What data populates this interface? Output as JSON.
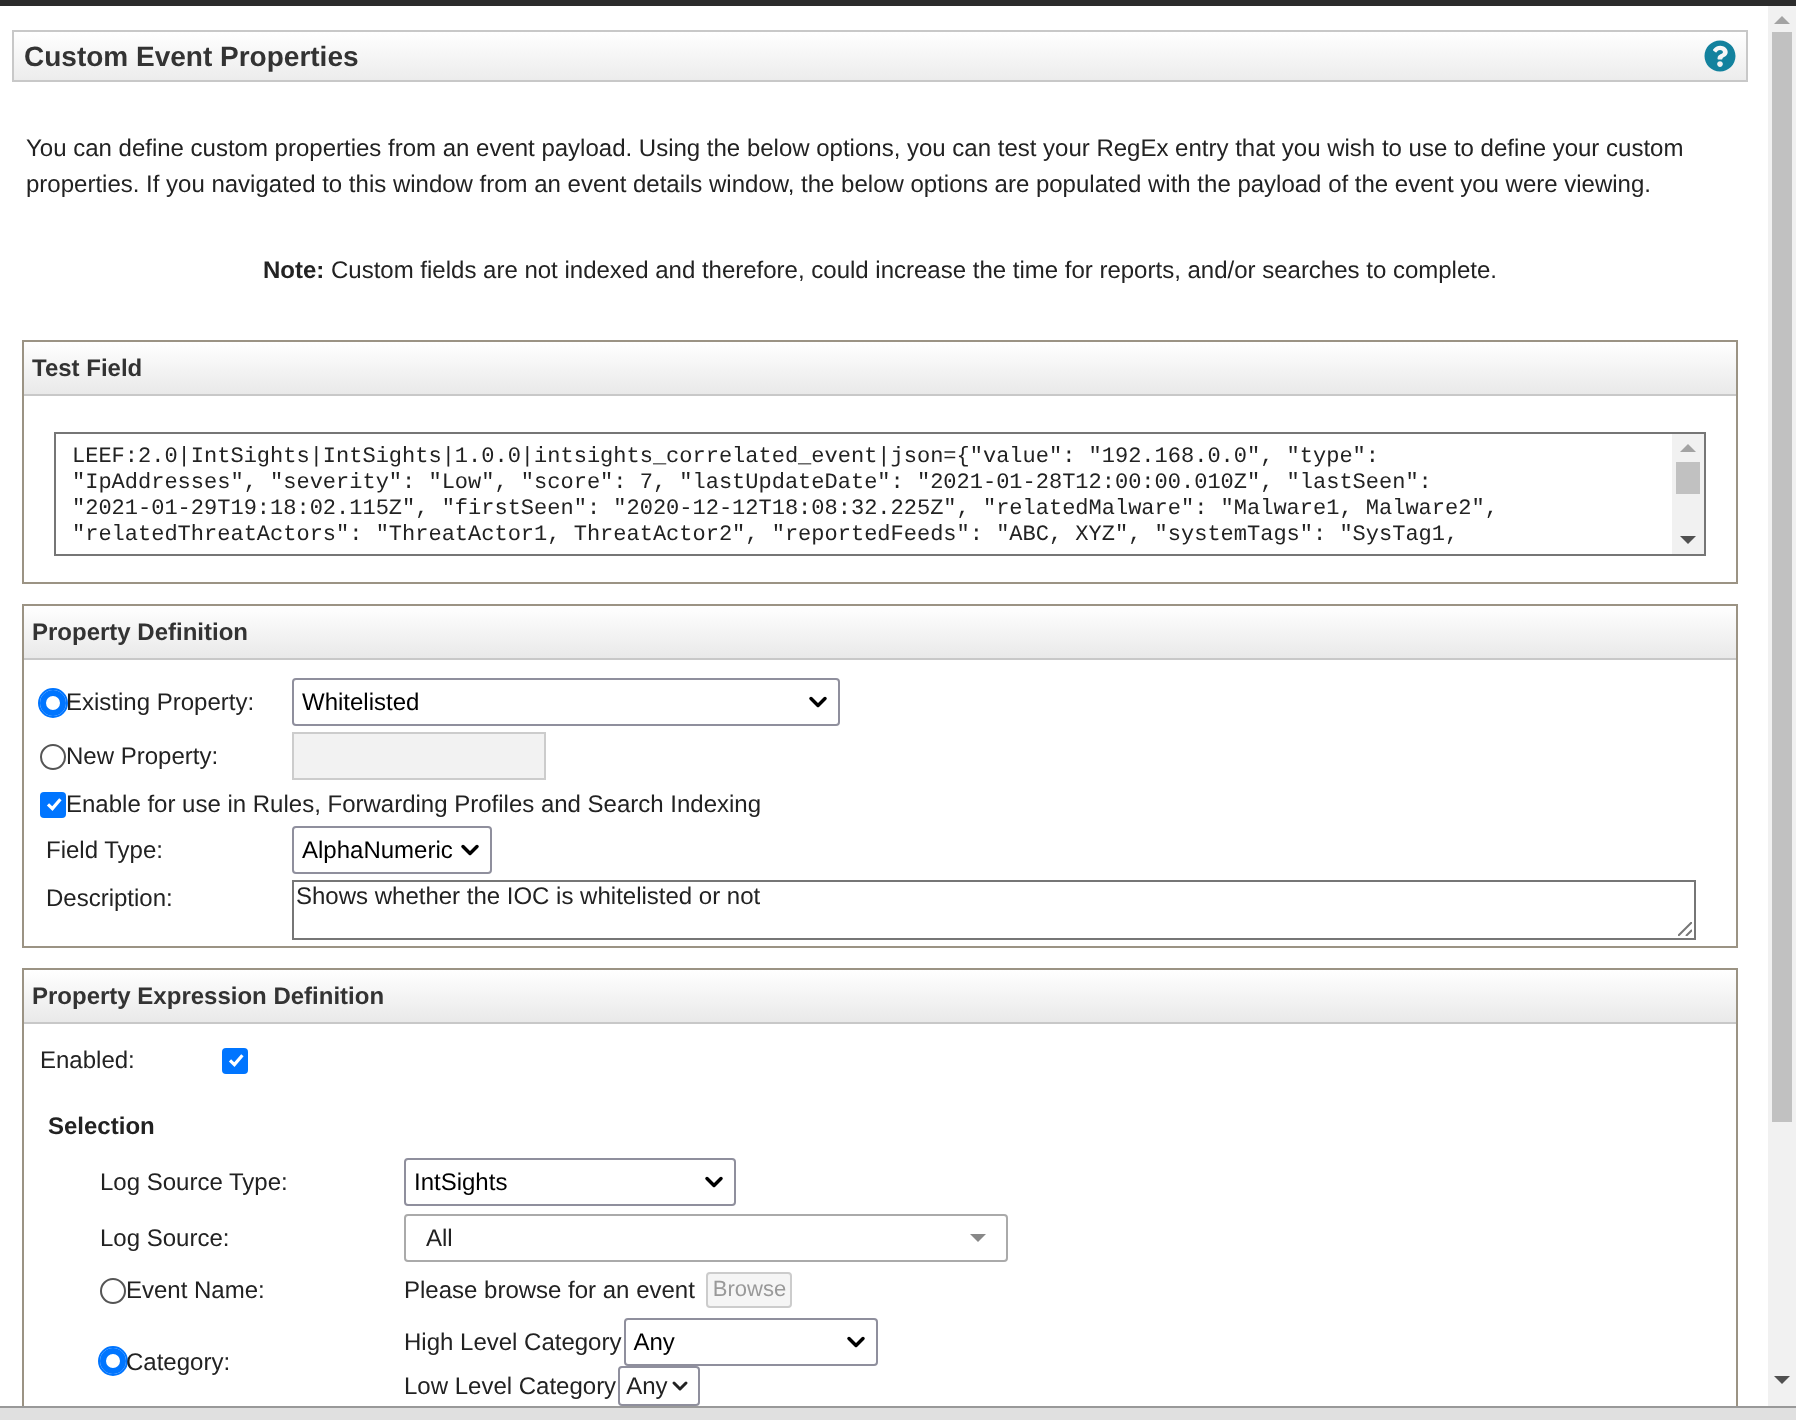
{
  "header": {
    "title": "Custom Event Properties"
  },
  "intro": "You can define custom properties from an event payload. Using the below options, you can test your RegEx entry that you wish to use to define your custom properties. If you navigated to this window from an event details window, the below options are populated with the payload of the event you were viewing.",
  "note": "**Note:** Custom fields are not indexed and therefore, could increase the time for reports, and/or searches to complete.",
  "test_field": {
    "title": "Test Field",
    "payload": [
      "LEEF:2.0|IntSights|IntSights|1.0.0|intsights_correlated_event|json={\"value\": \"192.168.0.0\", \"type\":",
      "\"IpAddresses\", \"severity\": \"Low\", \"score\": 7, \"lastUpdateDate\": \"2021-01-28T12:00:00.010Z\", \"lastSeen\":",
      "\"2021-01-29T19:18:02.115Z\", \"firstSeen\": \"2020-12-12T18:08:32.225Z\", \"relatedMalware\": \"Malware1, Malware2\",",
      "\"relatedThreatActors\": \"ThreatActor1, ThreatActor2\", \"reportedFeeds\": \"ABC, XYZ\", \"systemTags\": \"SysTag1,"
    ]
  },
  "property_definition": {
    "title": "Property Definition",
    "existing_property": {
      "label": "Existing Property:",
      "selected": true,
      "value": "Whitelisted"
    },
    "new_property": {
      "label": "New Property:",
      "selected": false
    },
    "enable_indexing": {
      "label": "Enable for use in Rules, Forwarding Profiles and Search Indexing",
      "checked": true
    },
    "field_type": {
      "label": "Field Type:",
      "value": "AlphaNumeric"
    },
    "description": {
      "label": "Description:",
      "value": "Shows whether the IOC is whitelisted or not"
    }
  },
  "expression_definition": {
    "title": "Property Expression Definition",
    "enabled": {
      "label": "Enabled:",
      "checked": true
    },
    "selection_title": "Selection",
    "log_source_type": {
      "label": "Log Source Type:",
      "value": "IntSights"
    },
    "log_source": {
      "label": "Log Source:",
      "value": "All"
    },
    "event_name": {
      "label": "Event Name:",
      "selected": false,
      "hint": "Please browse for an event",
      "button": "Browse",
      "button_disabled": true
    },
    "category": {
      "label": "Category:",
      "selected": true,
      "high_label": "High Level Category",
      "high_value": "Any",
      "low_label": "Low Level Category",
      "low_value": "Any"
    }
  }
}
